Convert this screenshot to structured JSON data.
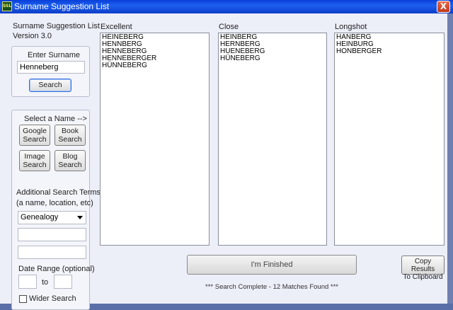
{
  "window": {
    "title": "Surname Suggestion List",
    "icon_text": "SSL",
    "close_label": "X"
  },
  "app": {
    "name": "Surname Suggestion List",
    "version": "Version 3.0"
  },
  "search_group": {
    "label": "Enter Surname",
    "input_value": "Henneberg",
    "button_label": "Search"
  },
  "select_group": {
    "label": "Select a Name -->",
    "buttons": [
      {
        "line1": "Google",
        "line2": "Search"
      },
      {
        "line1": "Book",
        "line2": "Search"
      },
      {
        "line1": "Image",
        "line2": "Search"
      },
      {
        "line1": "Blog",
        "line2": "Search"
      }
    ],
    "additional_label_1": "Additional Search Terms",
    "additional_label_2": "(a name, location, etc)",
    "dropdown_value": "Genealogy",
    "input1_value": "",
    "input2_value": "",
    "date_range_label": "Date Range (optional)",
    "date_from": "",
    "date_to_label": "to",
    "date_to": "",
    "wider_search_label": "Wider Search",
    "wider_search_checked": false
  },
  "columns": [
    {
      "label": "Excellent",
      "items": [
        "HEINEBERG",
        "HENNBERG",
        "HENNEBERG",
        "HENNEBERGER",
        "HÜNNEBERG"
      ]
    },
    {
      "label": "Close",
      "items": [
        "HEINBERG",
        "HERNBERG",
        "HUENEBERG",
        "HÜNEBERG"
      ]
    },
    {
      "label": "Longshot",
      "items": [
        "HANBERG",
        "HEINBURG",
        "HONBERGER"
      ]
    }
  ],
  "finished_label": "I'm Finished",
  "copy_label_1": "Copy Results",
  "copy_label_2": "To Clipboard",
  "status": "*** Search Complete - 12 Matches Found ***"
}
